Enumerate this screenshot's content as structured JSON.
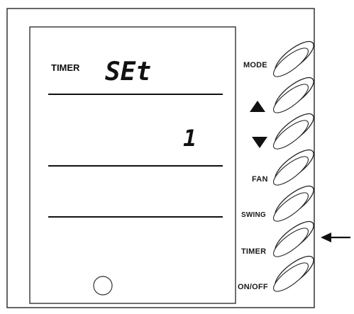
{
  "display": {
    "mode_label": "TIMER",
    "status_text": "SEt",
    "value": "1"
  },
  "buttons": [
    {
      "id": "mode",
      "label": "MODE"
    },
    {
      "id": "up",
      "label": "▲"
    },
    {
      "id": "down",
      "label": "▼"
    },
    {
      "id": "fan",
      "label": "FAN"
    },
    {
      "id": "swing",
      "label": "SWING"
    },
    {
      "id": "timer",
      "label": "TIMER"
    },
    {
      "id": "onoff",
      "label": "ON/OFF"
    }
  ],
  "indicated_button": "timer"
}
